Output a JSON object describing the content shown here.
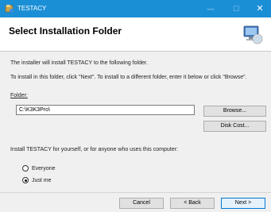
{
  "window": {
    "title": "TESTACY",
    "min_glyph": "—",
    "max_glyph": "☐",
    "close_glyph": "✕"
  },
  "header": {
    "title": "Select Installation Folder"
  },
  "body": {
    "intro": "The installer will install TESTACY to the following folder.",
    "instructions": "To install in this folder, click \"Next\". To install to a different folder, enter it below or click \"Browse\".",
    "folder_label": "Folder:",
    "folder_value": "C:\\K3K3Pro\\",
    "browse_label": "Browse...",
    "disk_cost_label": "Disk Cost...",
    "install_for_label": "Install TESTACY for yourself, or for anyone who uses this computer:",
    "options": [
      {
        "label": "Everyone",
        "checked": false
      },
      {
        "label": "Just me",
        "checked": true
      }
    ]
  },
  "footer": {
    "cancel_label": "Cancel",
    "back_label": "< Back",
    "next_label": "Next >"
  },
  "colors": {
    "titlebar": "#1b8fd6",
    "background": "#f0f0f0"
  }
}
